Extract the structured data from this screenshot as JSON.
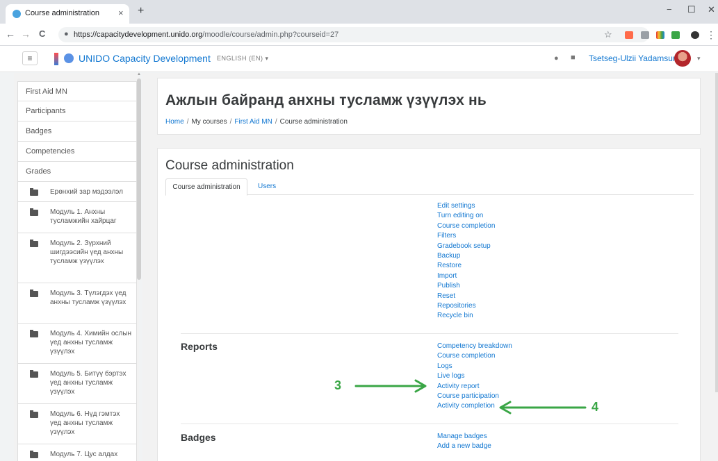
{
  "browser": {
    "tab_title": "Course administration",
    "tab_close": "×",
    "new_tab": "+",
    "window_controls": [
      "−",
      "☐",
      "✕"
    ],
    "url_host": "https://capacitydevelopment.unido.org",
    "url_path": "/moodle/course/admin.php?courseid=27",
    "back": "←",
    "forward": "→",
    "reload": "C",
    "lock": "🔒",
    "star": "☆",
    "menu": "⋮"
  },
  "navbar": {
    "menu_icon": "≡",
    "site_name": "UNIDO Capacity Development",
    "language": "ENGLISH (EN) ▾",
    "bell_icon": "●",
    "chat_icon": "■",
    "user_name": "Tsetseg-Ulzii Yadamsuren",
    "user_caret": "▾"
  },
  "drawer": {
    "items": [
      "First Aid MN",
      "Participants",
      "Badges",
      "Competencies",
      "Grades"
    ],
    "sections": [
      "Ерөнхий зар мэдээлэл",
      "Модуль 1. Анхны тусламжийн хайрцаг",
      "Модуль 2. Зүрхний шигдээсийн үед анхны тусламж үзүүлэх",
      "Модуль 3. Түлэгдэх үед анхны тусламж үзүүлэх",
      "Модуль 4. Химийн ослын үед анхны тусламж үзүүлэх",
      "Модуль 5. Битүү бэртэх үед анхны тусламж үзүүлэх",
      "Модуль 6. Нүд гэмтэх үед анхны тусламж үзүүлэх",
      "Модуль 7. Цус алдах"
    ],
    "scroll_up": "▲"
  },
  "header": {
    "title": "Ажлын байранд анхны тусламж үзүүлэх нь",
    "breadcrumb": {
      "home": "Home",
      "sep": "/",
      "my_courses": "My courses",
      "course": "First Aid MN",
      "current": "Course administration"
    }
  },
  "admin": {
    "title": "Course administration",
    "tabs": [
      "Course administration",
      "Users"
    ],
    "course_links": [
      "Edit settings",
      "Turn editing on",
      "Course completion",
      "Filters",
      "Gradebook setup",
      "Backup",
      "Restore",
      "Import",
      "Publish",
      "Reset",
      "Repositories",
      "Recycle bin"
    ],
    "reports_label": "Reports",
    "reports_links": [
      "Competency breakdown",
      "Course completion",
      "Logs",
      "Live logs",
      "Activity report",
      "Course participation",
      "Activity completion"
    ],
    "badges_label": "Badges",
    "badges_links": [
      "Manage badges",
      "Add a new badge"
    ]
  },
  "annotations": {
    "num_3": "3",
    "num_4": "4",
    "arrow_color": "#3aa646"
  },
  "colors": {
    "link": "#1177d1",
    "text": "#373a3c",
    "page_bg": "#f2f2f2"
  }
}
